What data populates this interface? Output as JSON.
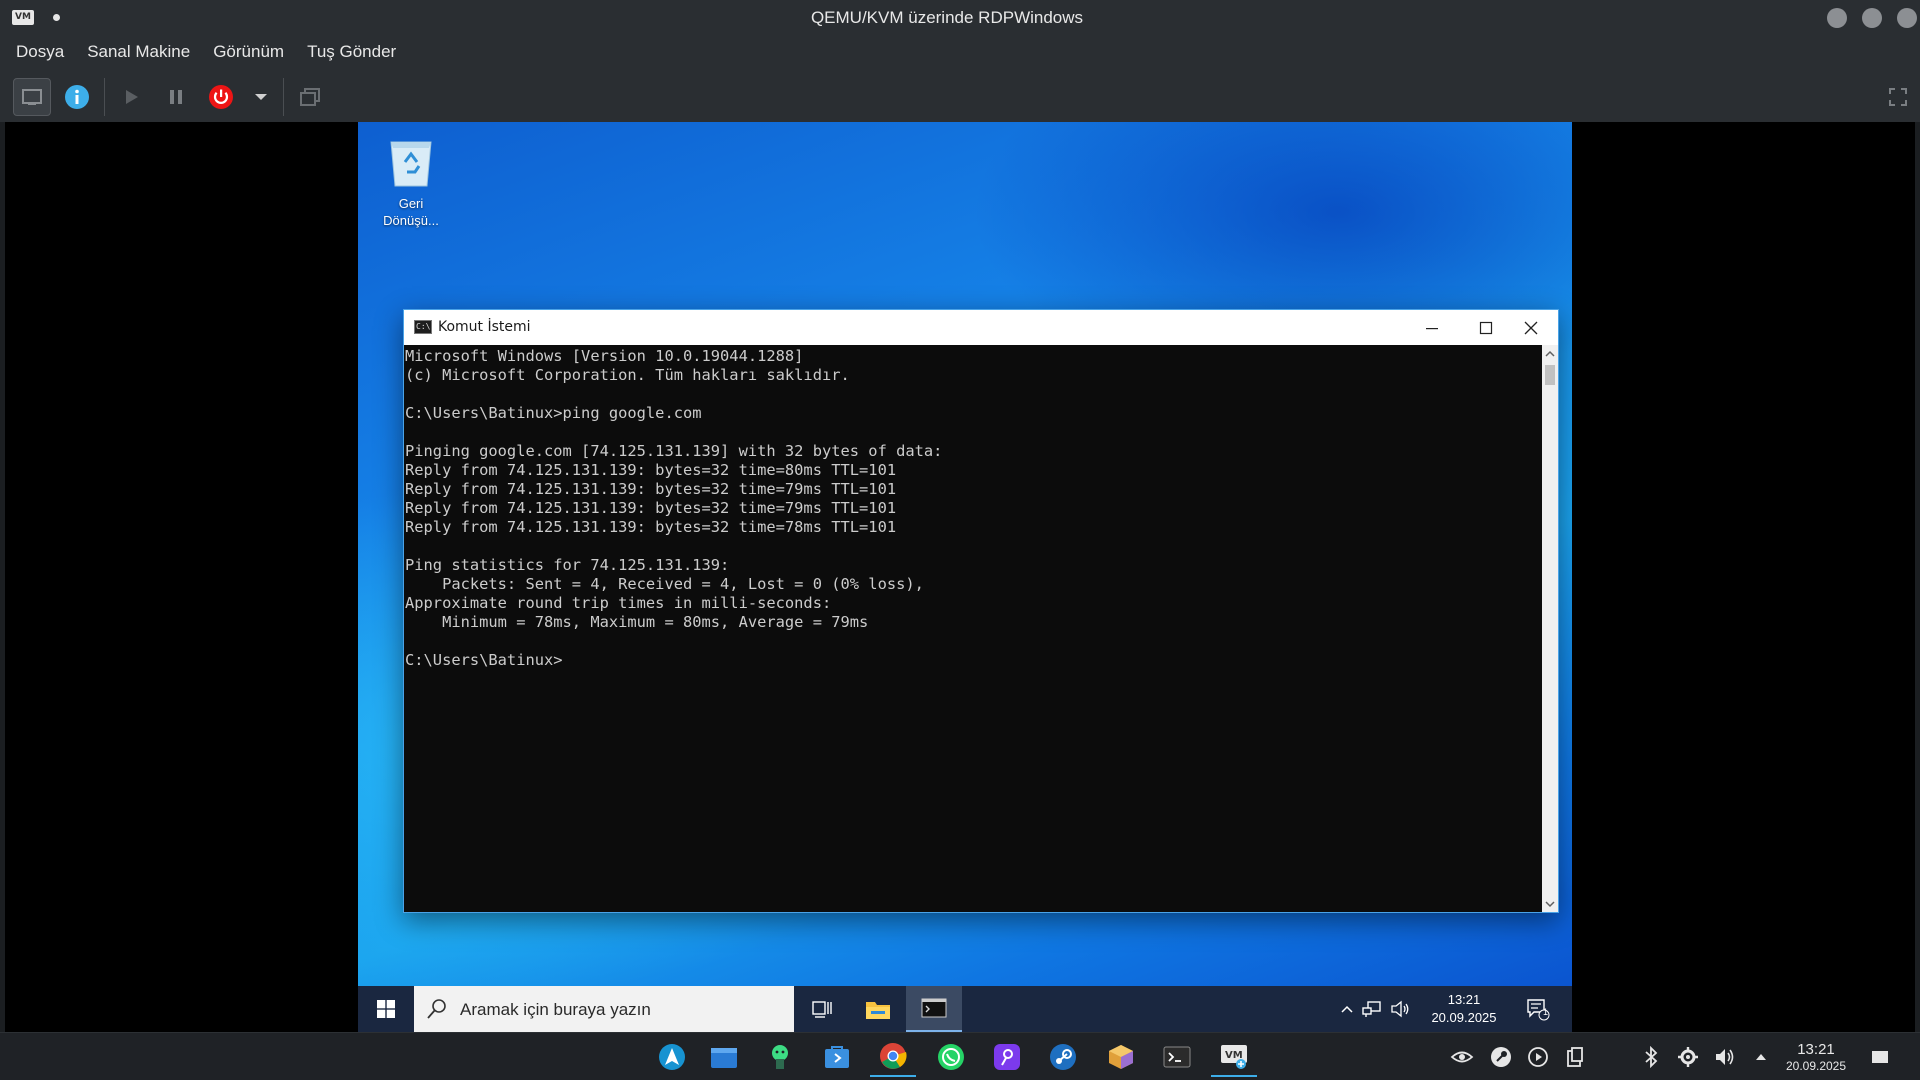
{
  "window": {
    "title": "QEMU/KVM üzerinde RDPWindows",
    "logo_text": "VM"
  },
  "menubar": {
    "items": [
      "Dosya",
      "Sanal Makine",
      "Görünüm",
      "Tuş Gönder"
    ]
  },
  "toolbar": {
    "buttons": [
      {
        "name": "console-icon"
      },
      {
        "name": "info-icon",
        "color": "#3daee9"
      },
      {
        "name": "run-icon"
      },
      {
        "name": "pause-icon"
      },
      {
        "name": "shutdown-icon",
        "color": "#ed1515"
      },
      {
        "name": "chevron-down-icon"
      },
      {
        "name": "snapshot-icon"
      },
      {
        "name": "fullscreen-icon"
      }
    ]
  },
  "guest": {
    "desktop_icons": [
      {
        "label_line1": "Geri",
        "label_line2": "Dönüşü..."
      }
    ],
    "cmd": {
      "title": "Komut İstemi",
      "lines": [
        "Microsoft Windows [Version 10.0.19044.1288]",
        "(c) Microsoft Corporation. Tüm hakları saklıdır.",
        "",
        "C:\\Users\\Batinux>ping google.com",
        "",
        "Pinging google.com [74.125.131.139] with 32 bytes of data:",
        "Reply from 74.125.131.139: bytes=32 time=80ms TTL=101",
        "Reply from 74.125.131.139: bytes=32 time=79ms TTL=101",
        "Reply from 74.125.131.139: bytes=32 time=79ms TTL=101",
        "Reply from 74.125.131.139: bytes=32 time=78ms TTL=101",
        "",
        "Ping statistics for 74.125.131.139:",
        "    Packets: Sent = 4, Received = 4, Lost = 0 (0% loss),",
        "Approximate round trip times in milli-seconds:",
        "    Minimum = 78ms, Maximum = 80ms, Average = 79ms",
        "",
        "C:\\Users\\Batinux>"
      ]
    },
    "taskbar": {
      "search_placeholder": "Aramak için buraya yazın",
      "time": "13:21",
      "date": "20.09.2025",
      "notification_count": "1"
    }
  },
  "host_taskbar": {
    "apps": [
      "arch-icon",
      "files-icon",
      "android-icon",
      "store-icon",
      "chrome-icon",
      "whatsapp-icon",
      "podcast-icon",
      "steam-icon",
      "package-icon",
      "terminal-icon",
      "virt-manager-icon"
    ],
    "time": "13:21",
    "date": "20.09.2025"
  },
  "colors": {
    "host_bg": "#2a2e32",
    "accent_blue": "#3daee9",
    "power_red": "#ed1515",
    "cmd_bg": "#0c0c0c",
    "cmd_text": "#cccccc"
  }
}
